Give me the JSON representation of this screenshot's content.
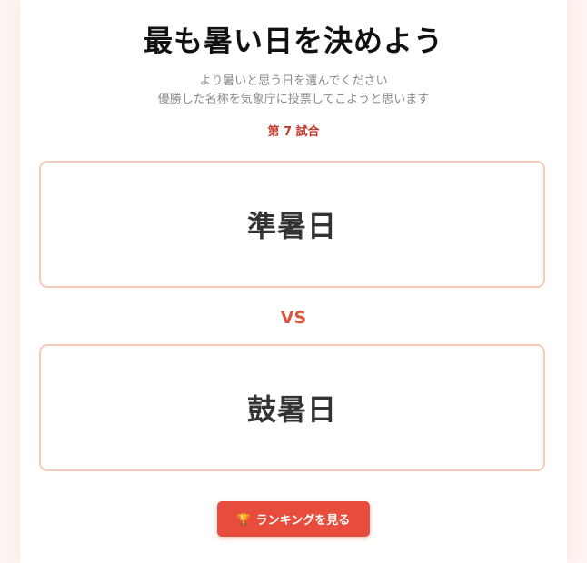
{
  "header": {
    "title": "最も暑い日を決めよう",
    "subtitle_line1": "より暑いと思う日を選んでください",
    "subtitle_line2": "優勝した名称を気象庁に投票してこようと思います"
  },
  "match": {
    "label": "第 7 試合"
  },
  "options": [
    {
      "label": "準暑日"
    },
    {
      "label": "鼓暑日"
    }
  ],
  "vs_label": "VS",
  "ranking_button": {
    "icon": "trophy-icon",
    "icon_glyph": "🏆",
    "label": "ランキングを見る"
  },
  "colors": {
    "accent": "#e74c3c",
    "match_label": "#c0392b",
    "vs": "#e0533d",
    "option_border": "#f8c9b6",
    "page_background": "#fdf3f0"
  }
}
